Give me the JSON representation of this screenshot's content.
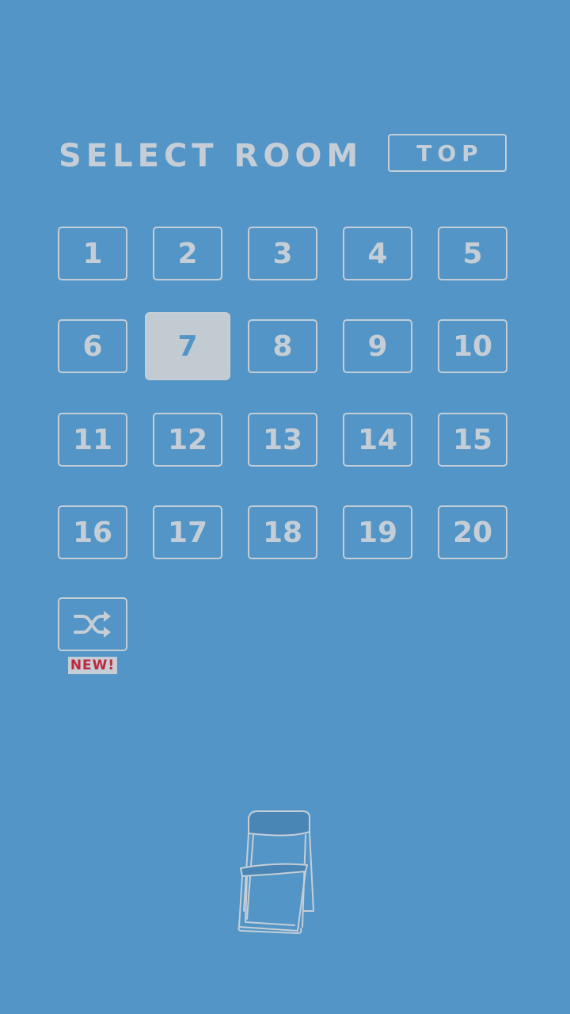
{
  "header": {
    "title": "SELECT ROOM",
    "top_button_label": "TOP"
  },
  "rooms": [
    "1",
    "2",
    "3",
    "4",
    "5",
    "6",
    "7",
    "8",
    "9",
    "10",
    "11",
    "12",
    "13",
    "14",
    "15",
    "16",
    "17",
    "18",
    "19",
    "20"
  ],
  "selected_room": "7",
  "shuffle": {
    "icon": "shuffle-icon",
    "badge": "NEW!"
  },
  "decoration": {
    "icon": "folding-chair"
  },
  "colors": {
    "background": "#5295c6",
    "foreground": "#c5ced6",
    "badge_text": "#c0283c"
  }
}
